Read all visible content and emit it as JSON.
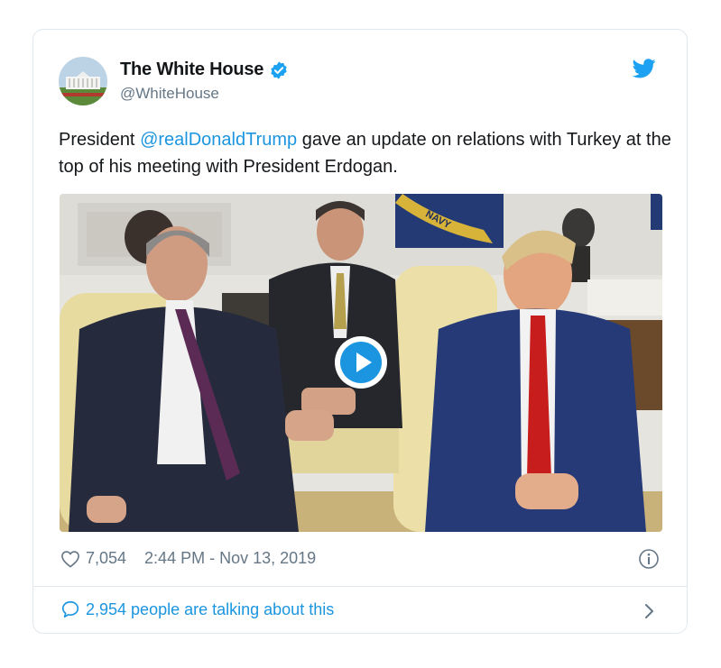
{
  "tweet": {
    "author": {
      "display_name": "The White House",
      "handle": "@WhiteHouse",
      "verified": true
    },
    "text": {
      "prefix": "President ",
      "mention": "@realDonaldTrump",
      "suffix": " gave an update on relations with Turkey at the top of his meeting with President Erdogan."
    },
    "media": {
      "type": "video",
      "flag_text": "NAVY"
    },
    "likes": "7,054",
    "timestamp": "2:44 PM - Nov 13, 2019",
    "talking": "2,954 people are talking about this"
  },
  "colors": {
    "link": "#1b95e0",
    "secondary_text": "#657786",
    "primary_text": "#14171a",
    "border": "#e1e8ed"
  },
  "icons": [
    "white-house-avatar",
    "verified-badge-icon",
    "twitter-bird-icon",
    "play-icon",
    "heart-icon",
    "info-icon",
    "speech-bubble-icon",
    "chevron-right-icon"
  ]
}
